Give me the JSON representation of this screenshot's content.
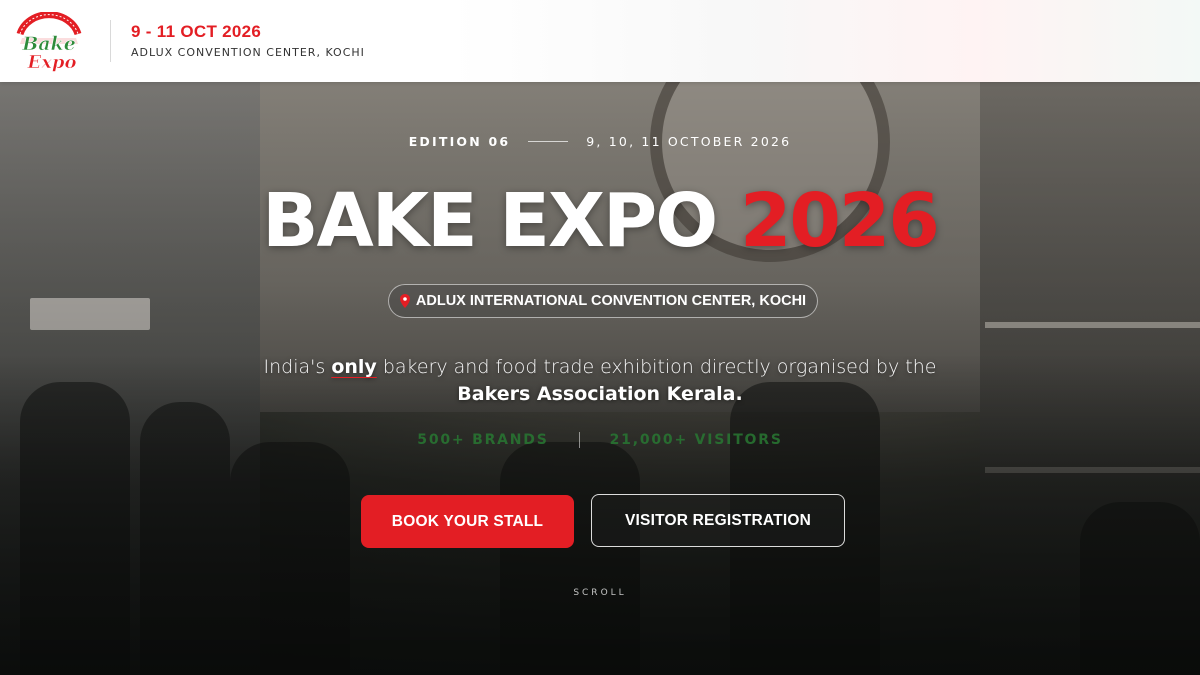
{
  "header": {
    "logo_text": "Bake Expo",
    "date": "9 - 11 OCT 2026",
    "venue": "ADLUX CONVENTION CENTER, KOCHI"
  },
  "hero": {
    "edition": "EDITION 06",
    "dates": "9, 10, 11 OCTOBER 2026",
    "title_main": "BAKE EXPO",
    "title_year": "2026",
    "venue_pill": "ADLUX INTERNATIONAL CONVENTION CENTER, KOCHI",
    "tagline_pre": "India's ",
    "tagline_only": "only",
    "tagline_post": " bakery and food trade exhibition directly organised by the",
    "tagline_org": "Bakers Association Kerala.",
    "stats": [
      "500+ BRANDS",
      "21,000+ VISITORS"
    ],
    "cta_book": "BOOK YOUR STALL",
    "cta_visitor": "VISITOR REGISTRATION",
    "scroll_label": "SCROLL"
  },
  "colors": {
    "accent_red": "#e31e24",
    "logo_green": "#2e8b3a",
    "white": "#ffffff"
  },
  "icons": [
    "bake-expo-logo",
    "map-pin-icon"
  ]
}
